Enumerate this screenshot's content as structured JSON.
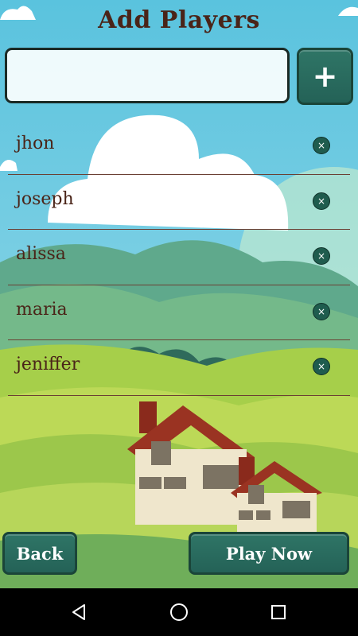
{
  "header": {
    "title": "Add Players"
  },
  "input": {
    "value": "",
    "placeholder": ""
  },
  "add_button": {
    "label": "+"
  },
  "players": [
    {
      "name": "jhon"
    },
    {
      "name": "joseph"
    },
    {
      "name": "alissa"
    },
    {
      "name": "maria"
    },
    {
      "name": "jeniffer"
    }
  ],
  "remove_icon": "×",
  "footer": {
    "back_label": "Back",
    "play_label": "Play Now"
  },
  "colors": {
    "accent": "#2a6b5e",
    "text": "#4a2418",
    "sky": "#58c4e0",
    "grass": "#9ccf4f"
  },
  "system_nav": {
    "icons": [
      "back-triangle-icon",
      "home-circle-icon",
      "recents-square-icon"
    ]
  }
}
